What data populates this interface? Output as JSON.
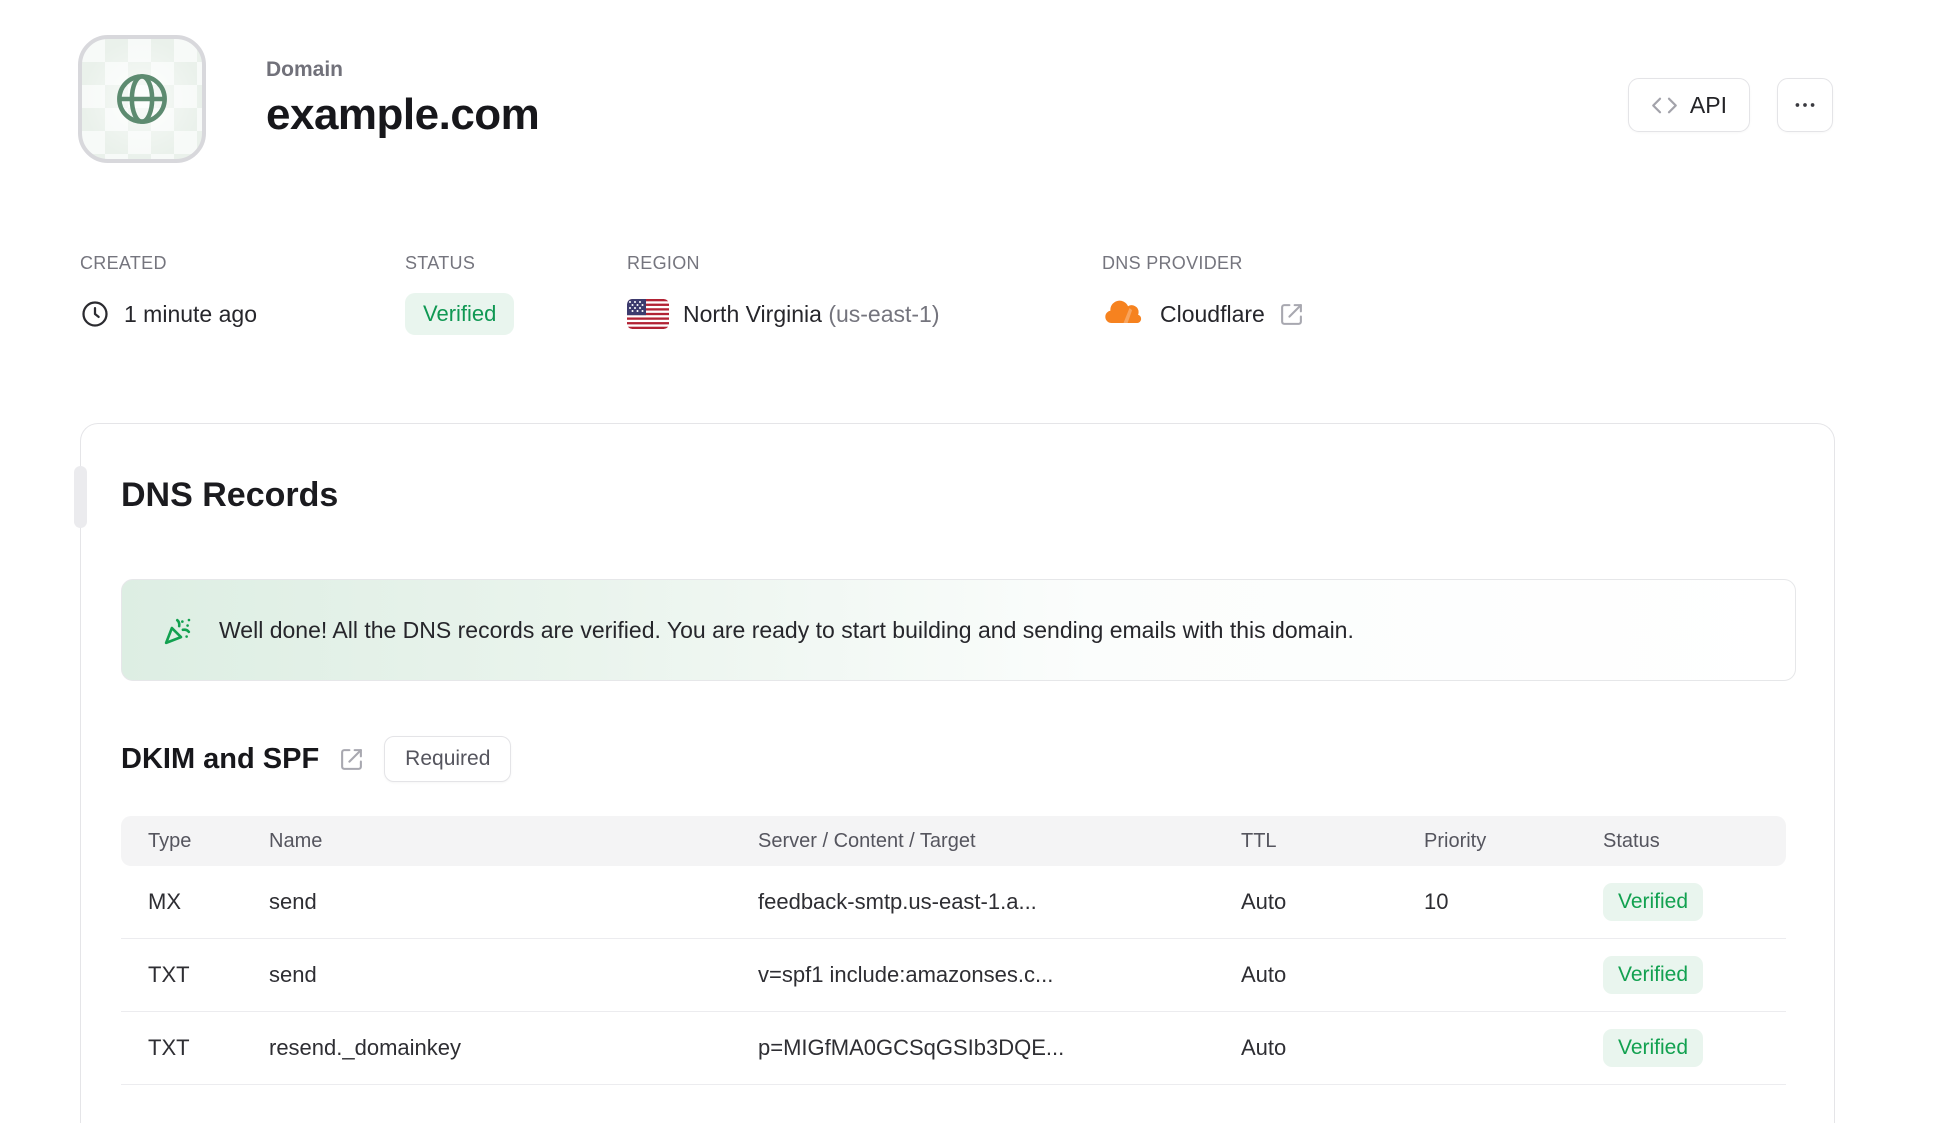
{
  "header": {
    "label": "Domain",
    "title": "example.com",
    "api_button": "API"
  },
  "meta": {
    "created": {
      "label": "CREATED",
      "value": "1 minute ago"
    },
    "status": {
      "label": "STATUS",
      "value": "Verified"
    },
    "region": {
      "label": "REGION",
      "name": "North Virginia",
      "code": "(us-east-1)"
    },
    "provider": {
      "label": "DNS PROVIDER",
      "value": "Cloudflare"
    }
  },
  "card": {
    "title": "DNS Records",
    "banner_text": "Well done! All the DNS records are verified. You are ready to start building and sending emails with this domain.",
    "section_title": "DKIM and SPF",
    "required_badge": "Required",
    "table": {
      "headers": [
        "Type",
        "Name",
        "Server / Content / Target",
        "TTL",
        "Priority",
        "Status"
      ],
      "rows": [
        {
          "type": "MX",
          "name": "send",
          "content": "feedback-smtp.us-east-1.a...",
          "ttl": "Auto",
          "priority": "10",
          "status": "Verified"
        },
        {
          "type": "TXT",
          "name": "send",
          "content": "v=spf1 include:amazonses.c...",
          "ttl": "Auto",
          "priority": "",
          "status": "Verified"
        },
        {
          "type": "TXT",
          "name": "resend._domainkey",
          "content": "p=MIGfMA0GCSqGSIb3DQE...",
          "ttl": "Auto",
          "priority": "",
          "status": "Verified"
        }
      ]
    }
  },
  "colors": {
    "accent_green": "#12a150",
    "badge_bg": "#e9f5ee",
    "badge_text": "#0f9853",
    "globe_green": "#5d8b70",
    "cloudflare_orange": "#f6821f"
  },
  "icons": {
    "avatar": "globe-icon",
    "created": "clock-icon",
    "region": "us-flag-icon",
    "provider": "cloudflare-icon",
    "banner": "party-popper-icon",
    "api": "code-icon",
    "more": "ellipsis-icon",
    "external": "external-link-icon"
  }
}
